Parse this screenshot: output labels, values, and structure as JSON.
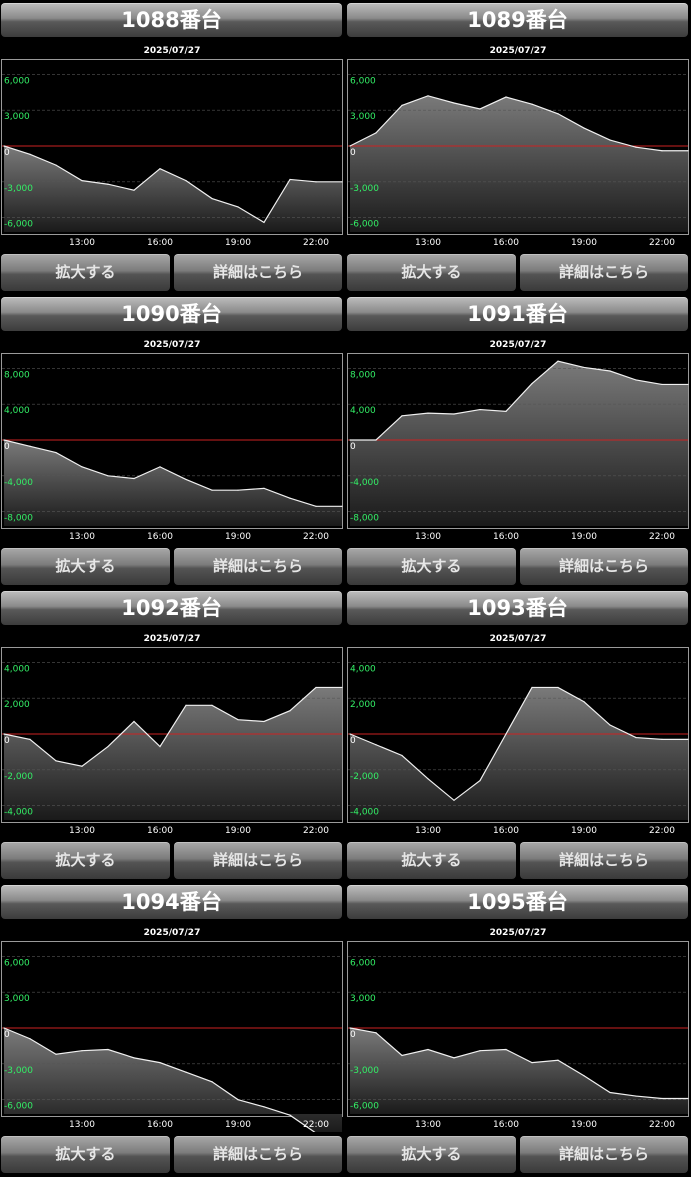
{
  "buttons": {
    "zoom_label": "拡大する",
    "detail_label": "詳細はこちら"
  },
  "colors": {
    "zero_line": "#cc2222",
    "positive_tick": "#33ee66",
    "zero_tick": "#ffffff",
    "series_line": "#f0f0f0"
  },
  "panels": [
    {
      "title": "1088番台",
      "date": "2025/07/27",
      "chart_data": {
        "type": "area",
        "x": [
          "10:00",
          "11:00",
          "12:00",
          "13:00",
          "14:00",
          "15:00",
          "16:00",
          "17:00",
          "18:00",
          "19:00",
          "20:00",
          "21:00",
          "22:00",
          "23:00"
        ],
        "xticks": [
          "13:00",
          "16:00",
          "19:00",
          "22:00"
        ],
        "yticks": [
          6000,
          3000,
          0,
          -3000,
          -6000
        ],
        "ytick_labels": [
          "6,000",
          "3,000",
          "0",
          "-3,000",
          "-6,000"
        ],
        "ylim": [
          -7200,
          7200
        ],
        "values": [
          0,
          -700,
          -1600,
          -2900,
          -3200,
          -3700,
          -1900,
          -2900,
          -4400,
          -5100,
          -6400,
          -2800,
          -3000,
          -3000
        ],
        "grid": true
      }
    },
    {
      "title": "1089番台",
      "date": "2025/07/27",
      "chart_data": {
        "type": "area",
        "x": [
          "10:00",
          "11:00",
          "12:00",
          "13:00",
          "14:00",
          "15:00",
          "16:00",
          "17:00",
          "18:00",
          "19:00",
          "20:00",
          "21:00",
          "22:00",
          "23:00"
        ],
        "xticks": [
          "13:00",
          "16:00",
          "19:00",
          "22:00"
        ],
        "yticks": [
          6000,
          3000,
          0,
          -3000,
          -6000
        ],
        "ytick_labels": [
          "6,000",
          "3,000",
          "0",
          "-3,000",
          "-6,000"
        ],
        "ylim": [
          -7200,
          7200
        ],
        "values": [
          0,
          1100,
          3400,
          4200,
          3600,
          3100,
          4100,
          3500,
          2700,
          1500,
          500,
          -100,
          -400,
          -400
        ],
        "grid": true
      }
    },
    {
      "title": "1090番台",
      "date": "2025/07/27",
      "chart_data": {
        "type": "area",
        "x": [
          "10:00",
          "11:00",
          "12:00",
          "13:00",
          "14:00",
          "15:00",
          "16:00",
          "17:00",
          "18:00",
          "19:00",
          "20:00",
          "21:00",
          "22:00",
          "23:00"
        ],
        "xticks": [
          "13:00",
          "16:00",
          "19:00",
          "22:00"
        ],
        "yticks": [
          8000,
          4000,
          0,
          -4000,
          -8000
        ],
        "ytick_labels": [
          "8,000",
          "4,000",
          "0",
          "-4,000",
          "-8,000"
        ],
        "ylim": [
          -9600,
          9600
        ],
        "values": [
          0,
          -700,
          -1400,
          -3000,
          -4000,
          -4300,
          -3000,
          -4400,
          -5600,
          -5600,
          -5400,
          -6500,
          -7400,
          -7400
        ],
        "grid": true
      }
    },
    {
      "title": "1091番台",
      "date": "2025/07/27",
      "chart_data": {
        "type": "area",
        "x": [
          "10:00",
          "11:00",
          "12:00",
          "13:00",
          "14:00",
          "15:00",
          "16:00",
          "17:00",
          "18:00",
          "19:00",
          "20:00",
          "21:00",
          "22:00",
          "23:00"
        ],
        "xticks": [
          "13:00",
          "16:00",
          "19:00",
          "22:00"
        ],
        "yticks": [
          8000,
          4000,
          0,
          -4000,
          -8000
        ],
        "ytick_labels": [
          "8,000",
          "4,000",
          "0",
          "-4,000",
          "-8,000"
        ],
        "ylim": [
          -9600,
          9600
        ],
        "values": [
          0,
          0,
          2700,
          3000,
          2900,
          3400,
          3200,
          6300,
          8800,
          8100,
          7700,
          6700,
          6200,
          6200
        ],
        "grid": true
      }
    },
    {
      "title": "1092番台",
      "date": "2025/07/27",
      "chart_data": {
        "type": "area",
        "x": [
          "10:00",
          "11:00",
          "12:00",
          "13:00",
          "14:00",
          "15:00",
          "16:00",
          "17:00",
          "18:00",
          "19:00",
          "20:00",
          "21:00",
          "22:00",
          "23:00"
        ],
        "xticks": [
          "13:00",
          "16:00",
          "19:00",
          "22:00"
        ],
        "yticks": [
          4000,
          2000,
          0,
          -2000,
          -4000
        ],
        "ytick_labels": [
          "4,000",
          "2,000",
          "0",
          "-2,000",
          "-4,000"
        ],
        "ylim": [
          -4800,
          4800
        ],
        "values": [
          0,
          -300,
          -1500,
          -1800,
          -700,
          700,
          -700,
          1600,
          1600,
          800,
          700,
          1300,
          2600,
          2600
        ],
        "grid": true
      }
    },
    {
      "title": "1093番台",
      "date": "2025/07/27",
      "chart_data": {
        "type": "area",
        "x": [
          "10:00",
          "11:00",
          "12:00",
          "13:00",
          "14:00",
          "15:00",
          "16:00",
          "17:00",
          "18:00",
          "19:00",
          "20:00",
          "21:00",
          "22:00",
          "23:00"
        ],
        "xticks": [
          "13:00",
          "16:00",
          "19:00",
          "22:00"
        ],
        "yticks": [
          4000,
          2000,
          0,
          -2000,
          -4000
        ],
        "ytick_labels": [
          "4,000",
          "2,000",
          "0",
          "-2,000",
          "-4,000"
        ],
        "ylim": [
          -4800,
          4800
        ],
        "values": [
          0,
          -600,
          -1200,
          -2500,
          -3700,
          -2600,
          0,
          2600,
          2600,
          1800,
          500,
          -200,
          -300,
          -300
        ],
        "grid": true
      }
    },
    {
      "title": "1094番台",
      "date": "2025/07/27",
      "chart_data": {
        "type": "area",
        "x": [
          "10:00",
          "11:00",
          "12:00",
          "13:00",
          "14:00",
          "15:00",
          "16:00",
          "17:00",
          "18:00",
          "19:00",
          "20:00",
          "21:00",
          "22:00",
          "23:00"
        ],
        "xticks": [
          "13:00",
          "16:00",
          "19:00",
          "22:00"
        ],
        "yticks": [
          6000,
          3000,
          0,
          -3000,
          -6000
        ],
        "ytick_labels": [
          "6,000",
          "3,000",
          "0",
          "-3,000",
          "-6,000"
        ],
        "ylim": [
          -7200,
          7200
        ],
        "values": [
          0,
          -900,
          -2200,
          -1900,
          -1800,
          -2500,
          -2900,
          -3700,
          -4500,
          -6000,
          -6600,
          -7300,
          -8800,
          -8800
        ],
        "grid": true
      }
    },
    {
      "title": "1095番台",
      "date": "2025/07/27",
      "chart_data": {
        "type": "area",
        "x": [
          "10:00",
          "11:00",
          "12:00",
          "13:00",
          "14:00",
          "15:00",
          "16:00",
          "17:00",
          "18:00",
          "19:00",
          "20:00",
          "21:00",
          "22:00",
          "23:00"
        ],
        "xticks": [
          "13:00",
          "16:00",
          "19:00",
          "22:00"
        ],
        "yticks": [
          6000,
          3000,
          0,
          -3000,
          -6000
        ],
        "ytick_labels": [
          "6,000",
          "3,000",
          "0",
          "-3,000",
          "-6,000"
        ],
        "ylim": [
          -7200,
          7200
        ],
        "values": [
          0,
          -400,
          -2300,
          -1800,
          -2500,
          -1900,
          -1800,
          -2900,
          -2700,
          -4000,
          -5400,
          -5700,
          -5900,
          -5900
        ],
        "grid": true
      }
    }
  ]
}
